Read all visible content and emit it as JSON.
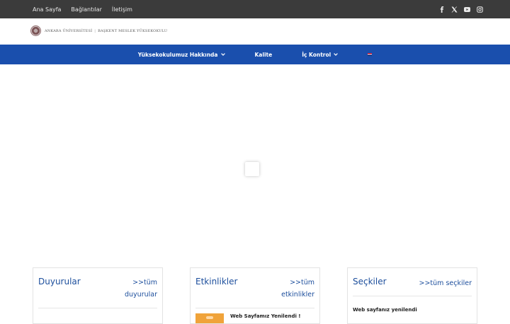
{
  "topbar": {
    "links": [
      "Ana Sayfa",
      "Bağlantılar",
      "İletişim"
    ],
    "social_icons": [
      "facebook-icon",
      "x-twitter-icon",
      "youtube-icon",
      "instagram-icon"
    ]
  },
  "logo": {
    "university": "ANKARA ÜNİVERSİTESİ",
    "school": "BAŞKENT MESLEK YÜKSEKOKULU"
  },
  "nav": {
    "items": [
      "Yüksekokulumuz Hakkında",
      "Kalite",
      "İç Kontrol"
    ],
    "language_icon": "uk-flag-icon"
  },
  "cards": [
    {
      "title": "Duyurular",
      "link_line1": ">>tüm",
      "link_line2": "duyurular"
    },
    {
      "title": "Etkinlikler",
      "link_line1": ">>tüm",
      "link_line2": "etkinlikler",
      "first_item": "Web Sayfamız Yenilendi !"
    },
    {
      "title": "Seçkiler",
      "link_line1": ">>tüm seçkiler",
      "first_item": "Web sayfanız yenilendi"
    }
  ],
  "colors": {
    "topbar": "#3b3b3b",
    "nav": "#1a4fad",
    "accent_blue": "#1c4e9c",
    "event_badge": "#f0a33a"
  }
}
